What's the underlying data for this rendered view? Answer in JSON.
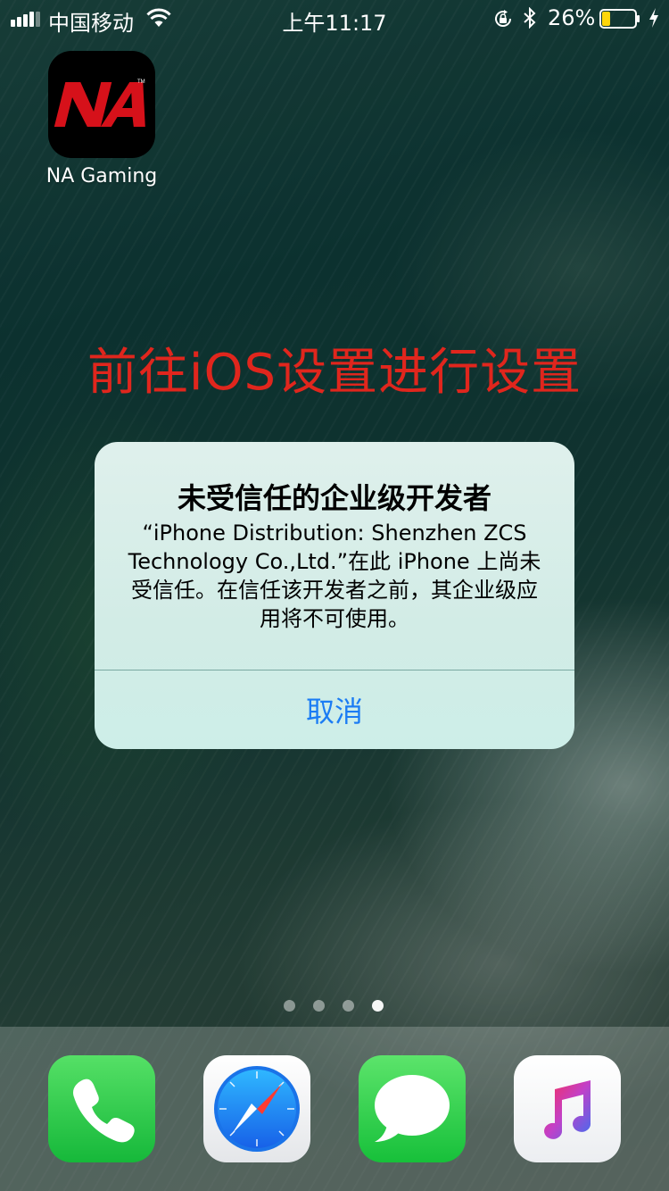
{
  "status_bar": {
    "carrier": "中国移动",
    "time": "上午11:17",
    "battery_percent": "26%",
    "battery_level": 0.26,
    "icons": [
      "signal-icon",
      "wifi-icon",
      "rotation-lock-icon",
      "bluetooth-icon",
      "battery-icon",
      "charging-icon"
    ]
  },
  "home": {
    "app": {
      "name": "NA Gaming",
      "icon_text": "NA",
      "icon_color": "#d6111a"
    },
    "banner": "前往iOS设置进行设置",
    "banner_color": "#e0261d",
    "page_dots": {
      "count": 4,
      "active_index": 3
    }
  },
  "alert": {
    "title": "未受信任的企业级开发者",
    "message": "“iPhone Distribution: Shenzhen ZCS Technology Co.,Ltd.”在此 iPhone 上尚未受信任。在信任该开发者之前，其企业级应用将不可使用。",
    "cancel_label": "取消",
    "accent_color": "#1b7cf4"
  },
  "dock": {
    "apps": [
      "phone-app-icon",
      "safari-app-icon",
      "messages-app-icon",
      "music-app-icon"
    ]
  }
}
